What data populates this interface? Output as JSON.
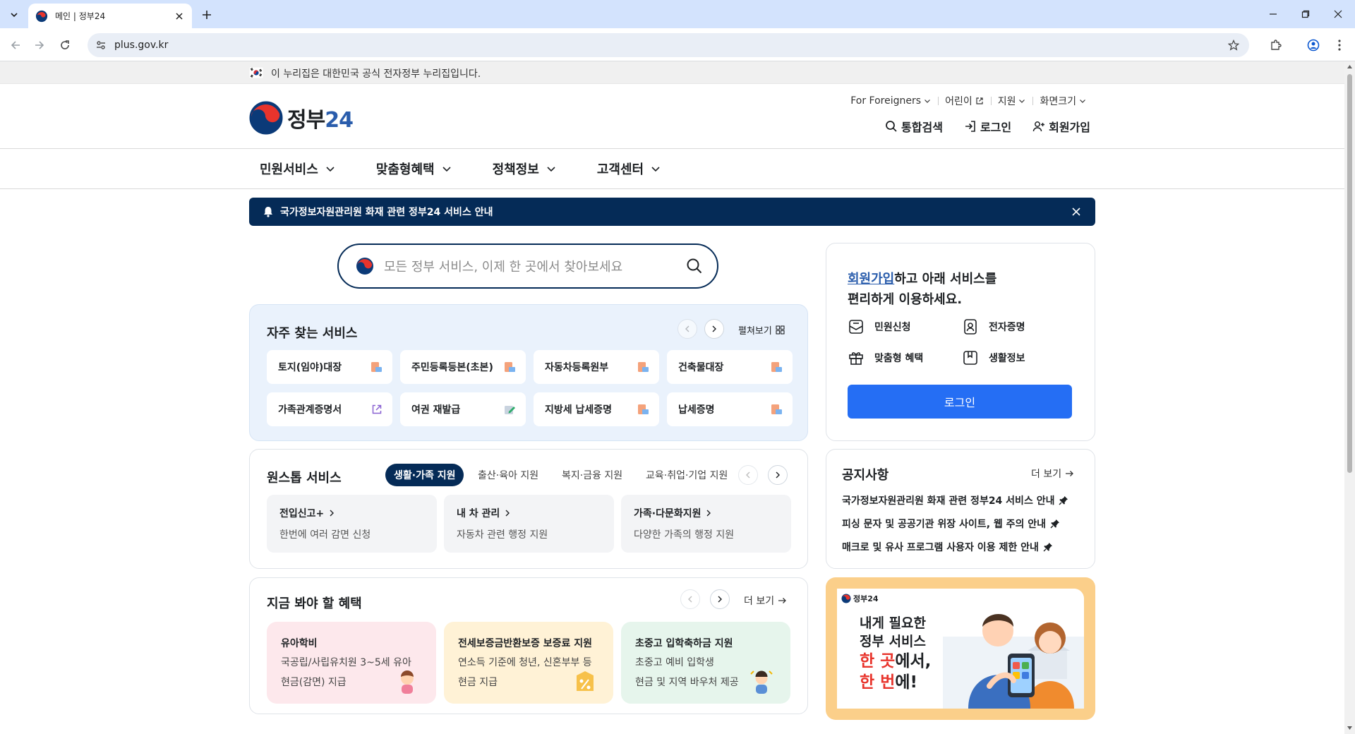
{
  "browser": {
    "tab_title": "메인 | 정부24",
    "url": "plus.gov.kr"
  },
  "gov_banner": {
    "text": "이 누리집은 대한민국 공식 전자정부 누리집입니다."
  },
  "header": {
    "logo_text": "정부",
    "logo_num": "24",
    "util": [
      "For Foreigners",
      "어린이",
      "지원",
      "화면크기"
    ],
    "search_label": "통합검색",
    "login_label": "로그인",
    "signup_label": "회원가입"
  },
  "gnb": [
    "민원서비스",
    "맞춤형혜택",
    "정책정보",
    "고객센터"
  ],
  "alert": {
    "text": "국가정보자원관리원 화재 관련 정부24 서비스 안내"
  },
  "search": {
    "placeholder": "모든 정부 서비스, 이제 한 곳에서 찾아보세요"
  },
  "frequent": {
    "title": "자주 찾는 서비스",
    "expand_label": "펼쳐보기",
    "items": [
      "토지(임야)대장",
      "주민등록등본(초본)",
      "자동차등록원부",
      "건축물대장",
      "가족관계증명서",
      "여권 재발급",
      "지방세 납세증명",
      "납세증명"
    ]
  },
  "onestop": {
    "title": "원스톱 서비스",
    "tabs": [
      "생활·가족 지원",
      "출산·육아 지원",
      "복지·금융 지원",
      "교육·취업·기업 지원"
    ],
    "items": [
      {
        "title": "전입신고+",
        "desc": "한번에 여러 감면 신청"
      },
      {
        "title": "내 차 관리",
        "desc": "자동차 관련 행정 지원"
      },
      {
        "title": "가족·다문화지원",
        "desc": "다양한 가족의 행정 지원"
      }
    ]
  },
  "benefits": {
    "title": "지금 봐야 할 혜택",
    "more_label": "더 보기",
    "items": [
      {
        "title": "유아학비",
        "line1": "국공립/사립유치원 3~5세 유아",
        "line2": "현금(감면) 지급"
      },
      {
        "title": "전세보증금반환보증 보증료 지원",
        "line1": "연소득 기준에 청년, 신혼부부 등",
        "line2": "현금 지급"
      },
      {
        "title": "초중고 입학축하금 지원",
        "line1": "초중고 예비 입학생",
        "line2": "현금 및 지역 바우처 제공"
      }
    ]
  },
  "login_box": {
    "lead_link": "회원가입",
    "lead_rest": "하고 아래 서비스를",
    "lead_line2": "편리하게 이용하세요.",
    "services": [
      "민원신청",
      "전자증명",
      "맞춤형 혜택",
      "생활정보"
    ],
    "button": "로그인"
  },
  "notice": {
    "title": "공지사항",
    "more_label": "더 보기",
    "items": [
      "국가정보자원관리원 화재 관련 정부24 서비스 안내",
      "피싱 문자 및 공공기관 위장 사이트, 웹 주의 안내",
      "매크로 및 유사 프로그램 사용자 이용 제한 안내"
    ]
  },
  "promo": {
    "logo_text": "정부24",
    "line1": "내게 필요한",
    "line2": "정부 서비스",
    "hl1": "한 곳",
    "mid": "에서,",
    "hl2": "한 번",
    "end": "에!"
  },
  "colors": {
    "navy": "#052b57",
    "blue": "#256ef4",
    "accent_red": "#e8342c",
    "link": "#2a5dac"
  }
}
